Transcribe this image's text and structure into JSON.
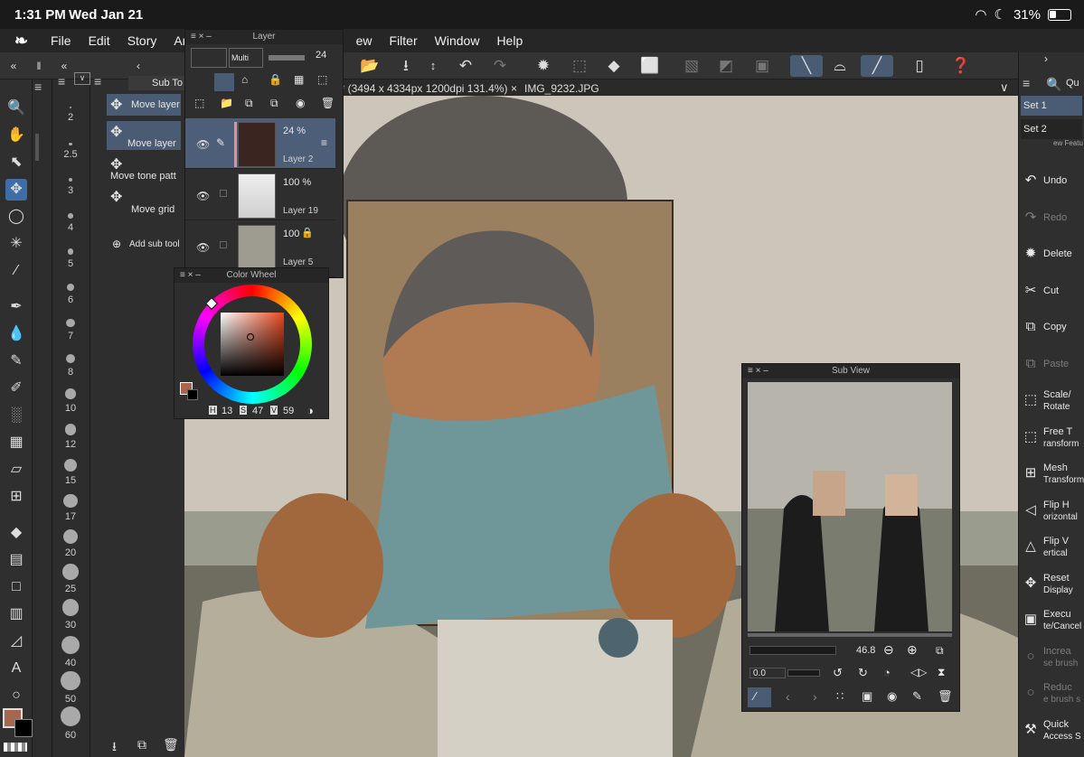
{
  "status": {
    "time": "1:31 PM",
    "date": "Wed Jan 21",
    "battery": "31%"
  },
  "menu": [
    "File",
    "Edit",
    "Story",
    "Ani",
    "ew",
    "Filter",
    "Window",
    "Help"
  ],
  "subtool": {
    "tab_label": "Sub To",
    "items": [
      "Move layer",
      "Move layer",
      "Move tone patt",
      "Move grid"
    ],
    "add_label": "Add sub tool"
  },
  "brush_sizes": [
    "2",
    "2.5",
    "3",
    "4",
    "5",
    "6",
    "7",
    "8",
    "10",
    "12",
    "15",
    "17",
    "20",
    "25",
    "30",
    "40",
    "50",
    "60"
  ],
  "doc_tabs": {
    "current": "7* (3494 x 4334px 1200dpi 131.4%)",
    "other": "IMG_9232.JPG"
  },
  "layer_panel": {
    "title": "Layer",
    "blend_mode": "Multi",
    "opacity_value": "24",
    "layers": [
      {
        "pct": "24 %",
        "name": "Layer 2"
      },
      {
        "pct": "100 %",
        "name": "Layer 19"
      },
      {
        "pct": "100",
        "name": "Layer 5"
      }
    ]
  },
  "color_wheel": {
    "title": "Color Wheel",
    "h_label": "H",
    "h": "13",
    "s_label": "S",
    "s": "47",
    "v_label": "V",
    "v": "59",
    "main_color": "#a5684f",
    "sub_color": "#000000"
  },
  "sub_view": {
    "title": "Sub View",
    "zoom": "46.8",
    "rotation": "0.0"
  },
  "quick": {
    "tab": "Qu",
    "sets": [
      "Set 1",
      "Set 2"
    ],
    "fragment": "ew Featu"
  },
  "right_actions": [
    {
      "line1": "Undo",
      "line2": "",
      "enabled": true
    },
    {
      "line1": "Redo",
      "line2": "",
      "enabled": false
    },
    {
      "line1": "Delete",
      "line2": "",
      "enabled": true
    },
    {
      "line1": "Cut",
      "line2": "",
      "enabled": true
    },
    {
      "line1": "Copy",
      "line2": "",
      "enabled": true
    },
    {
      "line1": "Paste",
      "line2": "",
      "enabled": false
    },
    {
      "line1": "Scale/",
      "line2": "Rotate",
      "enabled": true
    },
    {
      "line1": "Free T",
      "line2": "ransform",
      "enabled": true
    },
    {
      "line1": "Mesh",
      "line2": "Transform",
      "enabled": true
    },
    {
      "line1": "Flip H",
      "line2": "orizontal",
      "enabled": true
    },
    {
      "line1": "Flip V",
      "line2": "ertical",
      "enabled": true
    },
    {
      "line1": "Reset",
      "line2": "Display",
      "enabled": true
    },
    {
      "line1": "Execu",
      "line2": "te/Cancel",
      "enabled": true
    },
    {
      "line1": "Increa",
      "line2": "se brush",
      "enabled": false
    },
    {
      "line1": "Reduc",
      "line2": "e brush s",
      "enabled": false
    },
    {
      "line1": "Quick",
      "line2": "Access S",
      "enabled": true
    }
  ]
}
